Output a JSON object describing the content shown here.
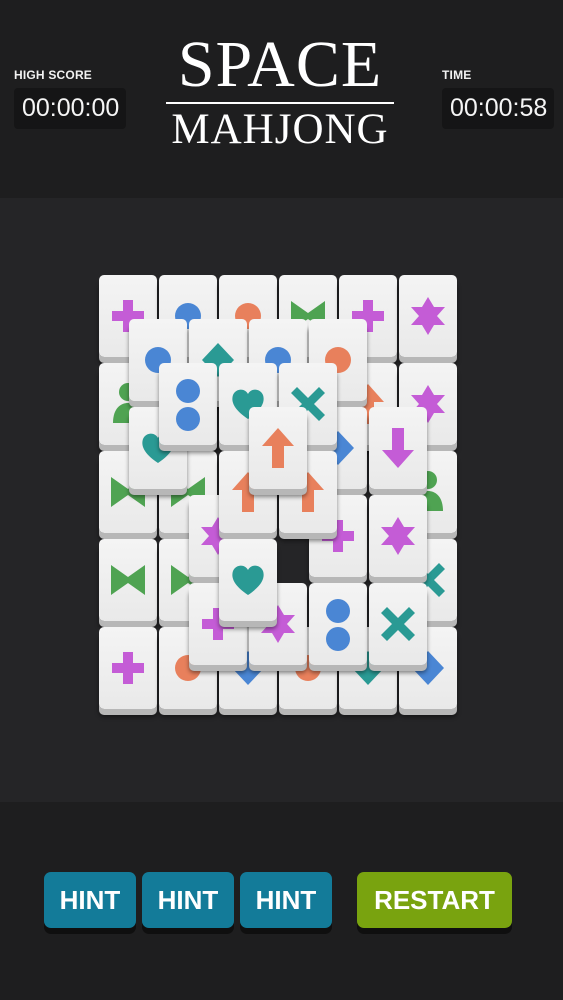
{
  "header": {
    "high_score_label": "HIGH SCORE",
    "high_score_value": "00:00:00",
    "time_label": "TIME",
    "time_value": "00:00:58",
    "title_line1": "SPACE",
    "title_line2": "MAHJONG"
  },
  "buttons": {
    "hint_1": "HINT",
    "hint_2": "HINT",
    "hint_3": "HINT",
    "restart": "RESTART"
  },
  "colors": {
    "background": "#1e1e1f",
    "board": "#252527",
    "tile_face": "#f0f0f0",
    "hint_button": "#137b99",
    "restart_button": "#79a30f",
    "symbol_purple": "#c45cd6",
    "symbol_blue": "#4a86d4",
    "symbol_orange": "#e8805c",
    "symbol_green": "#4fa352",
    "symbol_teal": "#2a9a94"
  },
  "tiles": [
    {
      "layer": 0,
      "row": 0,
      "col": 0,
      "symbol": "plus",
      "color": "purple"
    },
    {
      "layer": 0,
      "row": 0,
      "col": 1,
      "symbol": "circle",
      "color": "blue"
    },
    {
      "layer": 0,
      "row": 0,
      "col": 2,
      "symbol": "circle",
      "color": "orange"
    },
    {
      "layer": 0,
      "row": 0,
      "col": 3,
      "symbol": "bowtie",
      "color": "green"
    },
    {
      "layer": 0,
      "row": 0,
      "col": 4,
      "symbol": "plus",
      "color": "purple"
    },
    {
      "layer": 0,
      "row": 0,
      "col": 5,
      "symbol": "star",
      "color": "purple"
    },
    {
      "layer": 0,
      "row": 1,
      "col": 0,
      "symbol": "person",
      "color": "green"
    },
    {
      "layer": 0,
      "row": 1,
      "col": 1,
      "symbol": "circle",
      "color": "blue"
    },
    {
      "layer": 0,
      "row": 1,
      "col": 4,
      "symbol": "arrow-up",
      "color": "orange"
    },
    {
      "layer": 0,
      "row": 1,
      "col": 5,
      "symbol": "star",
      "color": "purple"
    },
    {
      "layer": 0,
      "row": 2,
      "col": 0,
      "symbol": "bowtie",
      "color": "green"
    },
    {
      "layer": 0,
      "row": 2,
      "col": 1,
      "symbol": "bowtie",
      "color": "green"
    },
    {
      "layer": 0,
      "row": 2,
      "col": 5,
      "symbol": "person",
      "color": "green"
    },
    {
      "layer": 0,
      "row": 3,
      "col": 0,
      "symbol": "bowtie",
      "color": "green"
    },
    {
      "layer": 0,
      "row": 3,
      "col": 1,
      "symbol": "bowtie",
      "color": "green"
    },
    {
      "layer": 0,
      "row": 3,
      "col": 5,
      "symbol": "cross",
      "color": "teal"
    },
    {
      "layer": 0,
      "row": 4,
      "col": 0,
      "symbol": "plus",
      "color": "purple"
    },
    {
      "layer": 0,
      "row": 4,
      "col": 1,
      "symbol": "circle",
      "color": "orange"
    },
    {
      "layer": 0,
      "row": 4,
      "col": 2,
      "symbol": "diamond",
      "color": "blue"
    },
    {
      "layer": 0,
      "row": 4,
      "col": 3,
      "symbol": "circle",
      "color": "orange"
    },
    {
      "layer": 0,
      "row": 4,
      "col": 4,
      "symbol": "diamond",
      "color": "teal"
    },
    {
      "layer": 0,
      "row": 4,
      "col": 5,
      "symbol": "diamond",
      "color": "blue"
    },
    {
      "layer": 1,
      "row": 0,
      "col": 0,
      "symbol": "circle",
      "color": "blue"
    },
    {
      "layer": 1,
      "row": 0,
      "col": 1,
      "symbol": "diamond",
      "color": "teal"
    },
    {
      "layer": 1,
      "row": 0,
      "col": 2,
      "symbol": "circle",
      "color": "blue"
    },
    {
      "layer": 1,
      "row": 0,
      "col": 3,
      "symbol": "circle",
      "color": "orange"
    },
    {
      "layer": 1,
      "row": 1,
      "col": 0,
      "symbol": "heart",
      "color": "teal"
    },
    {
      "layer": 1,
      "row": 1,
      "col": 3,
      "symbol": "diamond",
      "color": "blue"
    },
    {
      "layer": 1,
      "row": 1,
      "col": 4,
      "symbol": "arrow-down",
      "color": "purple"
    },
    {
      "layer": 1,
      "row": 2,
      "col": 1,
      "symbol": "star",
      "color": "purple"
    },
    {
      "layer": 1,
      "row": 2,
      "col": 3,
      "symbol": "plus",
      "color": "purple"
    },
    {
      "layer": 1,
      "row": 2,
      "col": 4,
      "symbol": "star",
      "color": "purple"
    },
    {
      "layer": 1,
      "row": 3,
      "col": 1,
      "symbol": "plus",
      "color": "purple"
    },
    {
      "layer": 1,
      "row": 3,
      "col": 2,
      "symbol": "star",
      "color": "purple"
    },
    {
      "layer": 1,
      "row": 3,
      "col": 3,
      "symbol": "two-circles",
      "color": "blue"
    },
    {
      "layer": 1,
      "row": 3,
      "col": 4,
      "symbol": "cross",
      "color": "teal"
    },
    {
      "layer": 2,
      "row": 0,
      "col": 0,
      "symbol": "two-circles",
      "color": "blue"
    },
    {
      "layer": 2,
      "row": 0,
      "col": 1,
      "symbol": "heart",
      "color": "teal"
    },
    {
      "layer": 2,
      "row": 0,
      "col": 2,
      "symbol": "cross",
      "color": "teal"
    },
    {
      "layer": 2,
      "row": 1,
      "col": 1,
      "symbol": "arrow-up",
      "color": "orange"
    },
    {
      "layer": 2,
      "row": 1,
      "col": 2,
      "symbol": "arrow-up",
      "color": "orange"
    },
    {
      "layer": 2,
      "row": 2,
      "col": 1,
      "symbol": "heart",
      "color": "teal"
    },
    {
      "layer": 3,
      "row": 0,
      "col": 0,
      "symbol": "arrow-up",
      "color": "orange"
    }
  ]
}
